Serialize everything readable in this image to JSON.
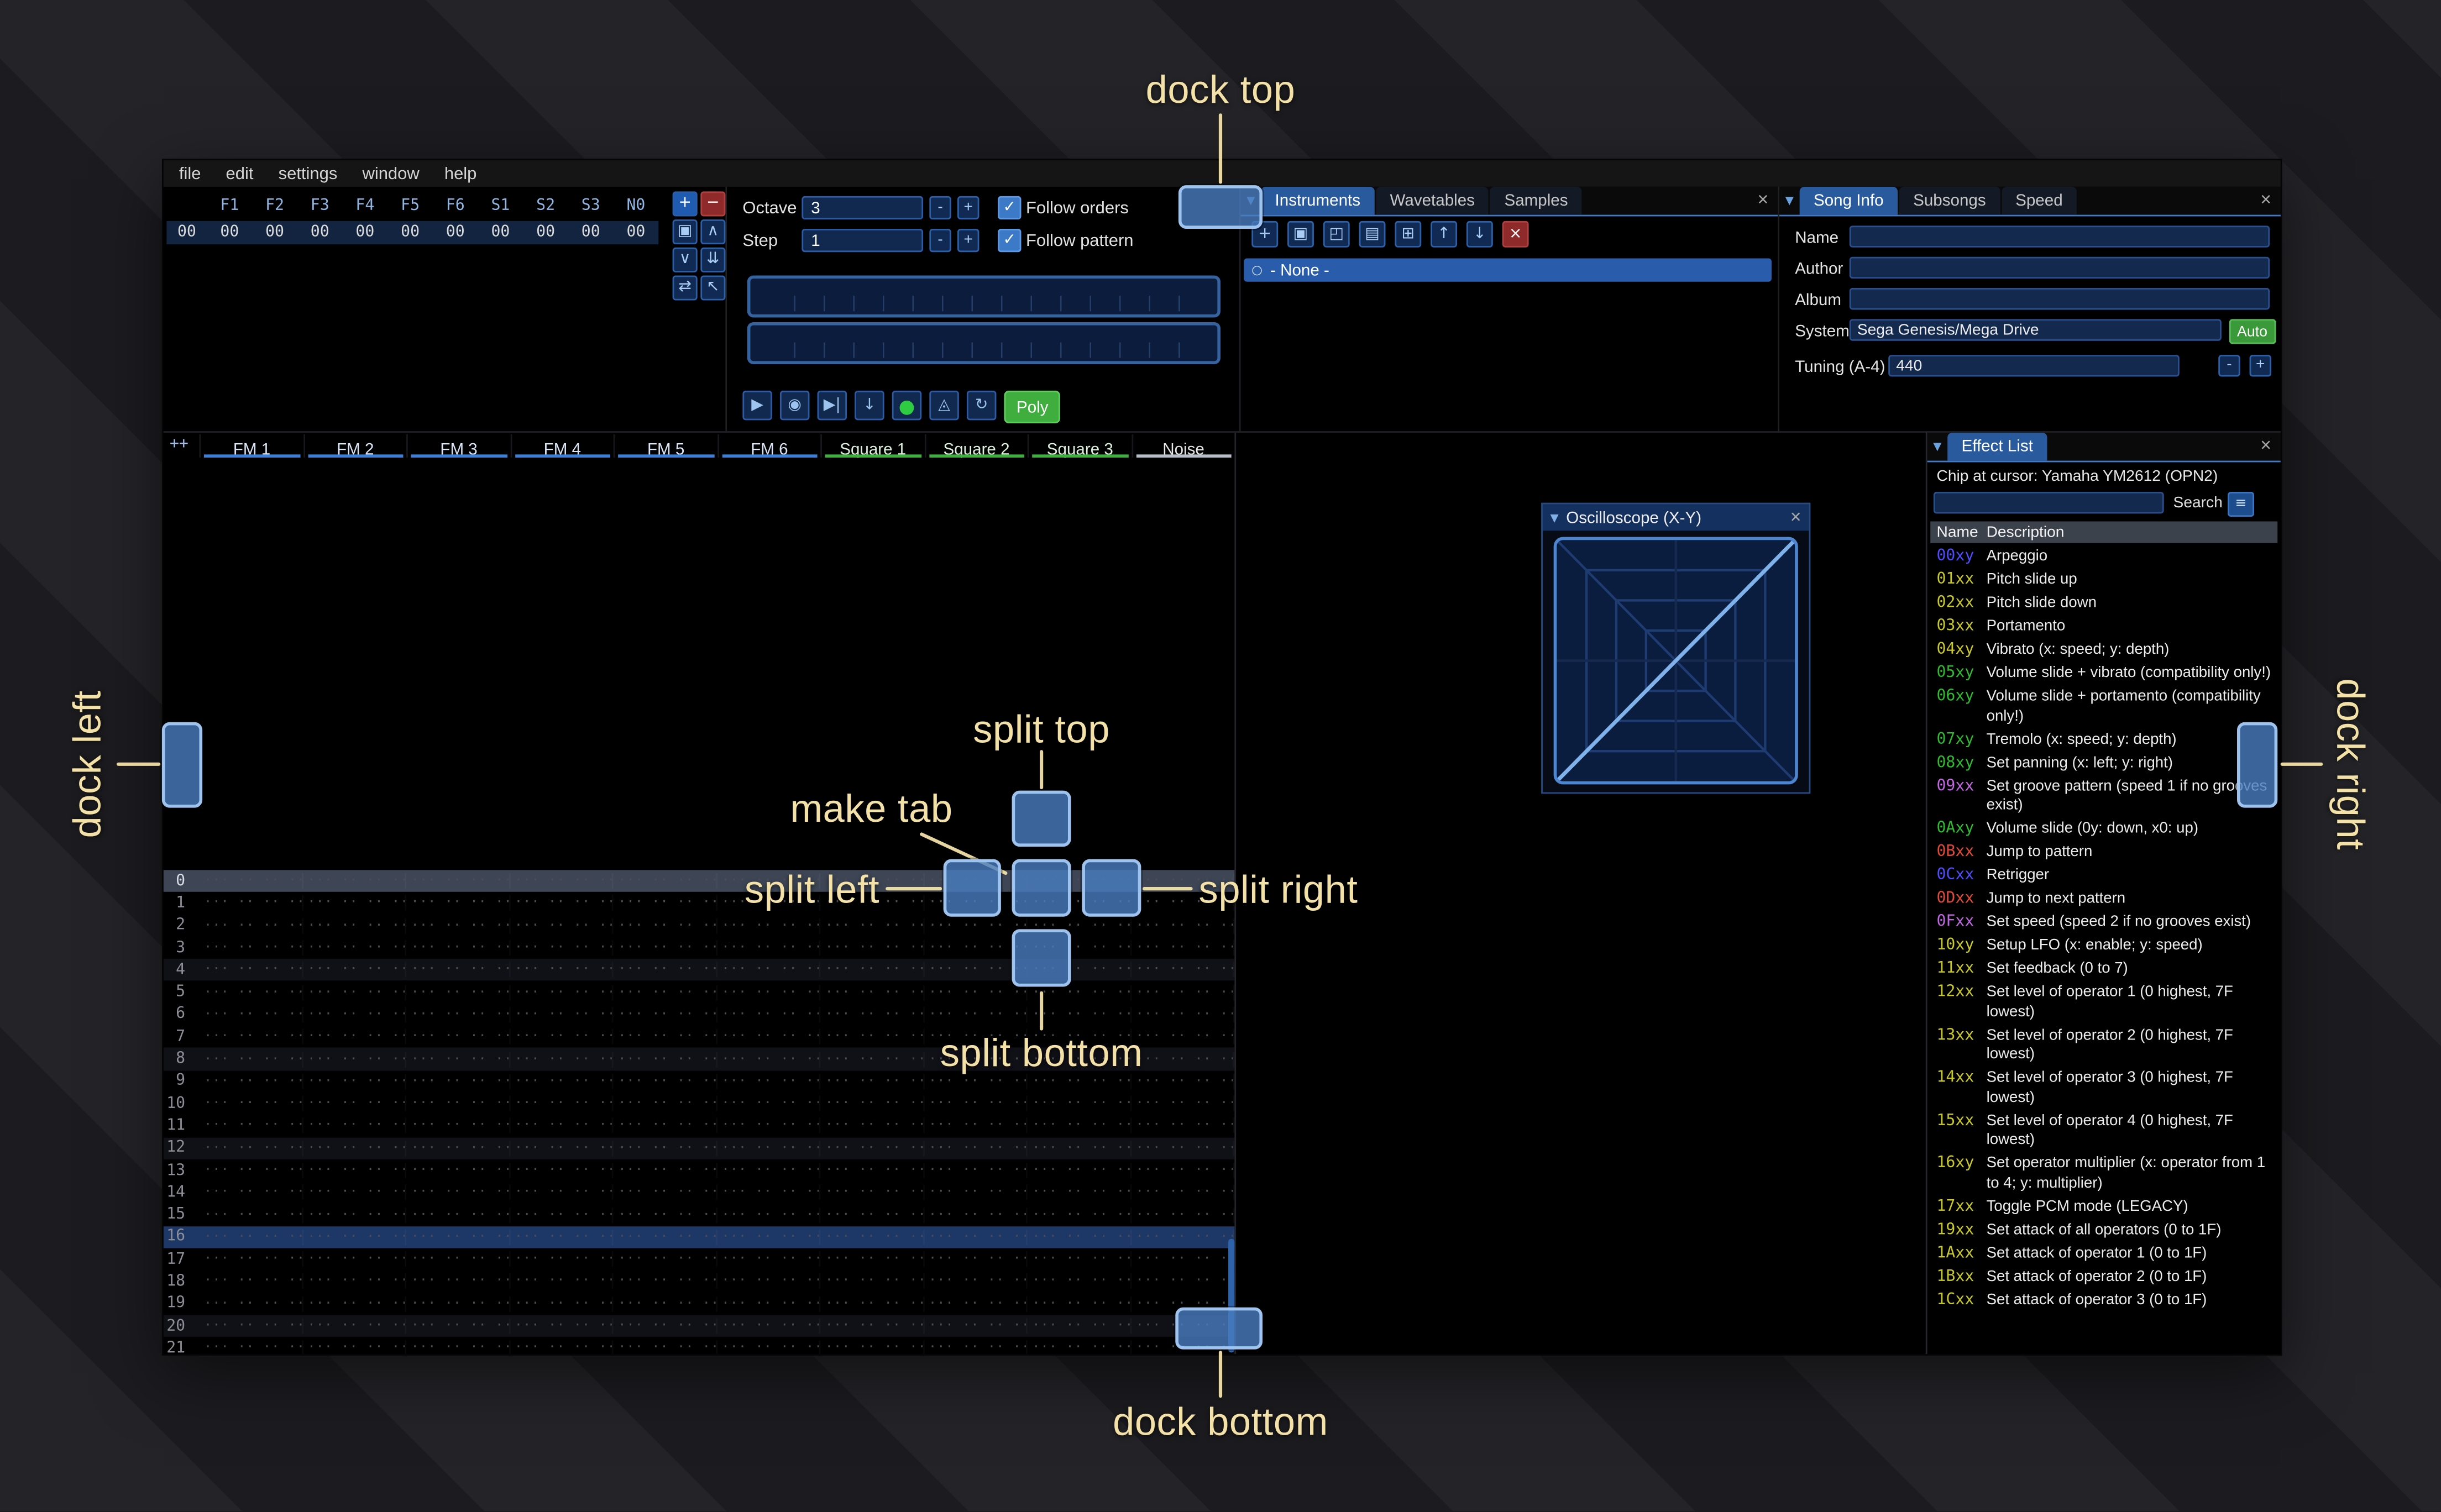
{
  "menu": {
    "items": [
      "file",
      "edit",
      "settings",
      "window",
      "help"
    ]
  },
  "orders": {
    "channels": [
      "F1",
      "F2",
      "F3",
      "F4",
      "F5",
      "F6",
      "S1",
      "S2",
      "S3",
      "N0"
    ],
    "row": {
      "index": "00",
      "cells": [
        "00",
        "00",
        "00",
        "00",
        "00",
        "00",
        "00",
        "00",
        "00",
        "00"
      ]
    },
    "buttons": [
      {
        "name": "order-add-button",
        "glyph": "+",
        "variant": "add"
      },
      {
        "name": "order-remove-button",
        "glyph": "−",
        "variant": "remove"
      },
      {
        "name": "order-duplicate-button",
        "glyph": "▣"
      },
      {
        "name": "order-move-up-button",
        "glyph": "∧"
      },
      {
        "name": "order-move-down-button",
        "glyph": "∨"
      },
      {
        "name": "order-duplicate-end-button",
        "glyph": "⇊"
      },
      {
        "name": "order-change-all-button",
        "glyph": "⇄"
      },
      {
        "name": "order-edit-mode-button",
        "glyph": "↖"
      }
    ]
  },
  "controls": {
    "octave_label": "Octave",
    "octave_value": "3",
    "step_label": "Step",
    "step_value": "1",
    "minus": "-",
    "plus": "+",
    "check": "✓",
    "follow_orders": "Follow orders",
    "follow_pattern": "Follow pattern",
    "transport": [
      {
        "name": "play-button",
        "glyph": "▶"
      },
      {
        "name": "play-pattern-button",
        "glyph": "◉"
      },
      {
        "name": "play-once-button",
        "glyph": "▶|"
      },
      {
        "name": "step-row-button",
        "glyph": "↓"
      },
      {
        "name": "edit-record-toggle",
        "glyph": "●",
        "variant": "record"
      },
      {
        "name": "metronome-button",
        "glyph": "◬"
      },
      {
        "name": "repeat-pattern-button",
        "glyph": "↻"
      }
    ],
    "poly_label": "Poly"
  },
  "instruments": {
    "tabs": [
      "Instruments",
      "Wavetables",
      "Samples"
    ],
    "toolbar": [
      {
        "name": "instrument-add-button",
        "glyph": "+"
      },
      {
        "name": "instrument-duplicate-button",
        "glyph": "▣"
      },
      {
        "name": "instrument-open-button",
        "glyph": "◰"
      },
      {
        "name": "instrument-save-button",
        "glyph": "▤"
      },
      {
        "name": "instrument-folder-button",
        "glyph": "⊞"
      },
      {
        "name": "instrument-move-up-button",
        "glyph": "↑"
      },
      {
        "name": "instrument-move-down-button",
        "glyph": "↓"
      },
      {
        "name": "instrument-delete-button",
        "glyph": "×",
        "variant": "danger"
      }
    ],
    "list": [
      {
        "bullet": "○",
        "label": "- None -"
      }
    ]
  },
  "song_info": {
    "tabs": [
      "Song Info",
      "Subsongs",
      "Speed"
    ],
    "fields": [
      {
        "label": "Name",
        "value": ""
      },
      {
        "label": "Author",
        "value": ""
      },
      {
        "label": "Album",
        "value": ""
      }
    ],
    "system_label": "System",
    "system_value": "Sega Genesis/Mega Drive",
    "auto_label": "Auto",
    "tuning_label": "Tuning (A-4)",
    "tuning_value": "440",
    "minus": "-",
    "plus": "+"
  },
  "pattern": {
    "corner": "++",
    "channels": [
      {
        "label": "FM 1",
        "type": "fm"
      },
      {
        "label": "FM 2",
        "type": "fm"
      },
      {
        "label": "FM 3",
        "type": "fm"
      },
      {
        "label": "FM 4",
        "type": "fm"
      },
      {
        "label": "FM 5",
        "type": "fm"
      },
      {
        "label": "FM 6",
        "type": "fm"
      },
      {
        "label": "Square 1",
        "type": "square"
      },
      {
        "label": "Square 2",
        "type": "square"
      },
      {
        "label": "Square 3",
        "type": "square"
      },
      {
        "label": "Noise",
        "type": "noise"
      }
    ],
    "empty_cell": "··· ·· ·· ····",
    "rows": [
      {
        "n": "0",
        "hl": "cursor"
      },
      {
        "n": "1"
      },
      {
        "n": "2"
      },
      {
        "n": "3"
      },
      {
        "n": "4",
        "hl": "minor"
      },
      {
        "n": "5"
      },
      {
        "n": "6"
      },
      {
        "n": "7"
      },
      {
        "n": "8",
        "hl": "minor"
      },
      {
        "n": "9"
      },
      {
        "n": "10"
      },
      {
        "n": "11"
      },
      {
        "n": "12",
        "hl": "minor"
      },
      {
        "n": "13"
      },
      {
        "n": "14"
      },
      {
        "n": "15"
      },
      {
        "n": "16",
        "hl": "major"
      },
      {
        "n": "17"
      },
      {
        "n": "18"
      },
      {
        "n": "19"
      },
      {
        "n": "20",
        "hl": "minor"
      },
      {
        "n": "21"
      }
    ]
  },
  "oscilloscope": {
    "title": "Oscilloscope (X-Y)"
  },
  "effect_list": {
    "tab": "Effect List",
    "chip_line": "Chip at cursor: Yamaha YM2612 (OPN2)",
    "search_label": "Search",
    "columns": [
      "Name",
      "Description"
    ],
    "palette": {
      "blue": "#4d4dff",
      "yellow": "#c9c929",
      "green": "#2fbb2f",
      "purple": "#bf66e0",
      "red": "#e0483a"
    },
    "effects": [
      {
        "code": "00xy",
        "desc": "Arpeggio",
        "color": "blue"
      },
      {
        "code": "01xx",
        "desc": "Pitch slide up",
        "color": "yellow"
      },
      {
        "code": "02xx",
        "desc": "Pitch slide down",
        "color": "yellow"
      },
      {
        "code": "03xx",
        "desc": "Portamento",
        "color": "yellow"
      },
      {
        "code": "04xy",
        "desc": "Vibrato (x: speed; y: depth)",
        "color": "yellow"
      },
      {
        "code": "05xy",
        "desc": "Volume slide + vibrato (compatibility only!)",
        "color": "green"
      },
      {
        "code": "06xy",
        "desc": "Volume slide + portamento (compatibility only!)",
        "color": "green"
      },
      {
        "code": "07xy",
        "desc": "Tremolo (x: speed; y: depth)",
        "color": "green"
      },
      {
        "code": "08xy",
        "desc": "Set panning (x: left; y: right)",
        "color": "green"
      },
      {
        "code": "09xx",
        "desc": "Set groove pattern (speed 1 if no grooves exist)",
        "color": "purple"
      },
      {
        "code": "0Axy",
        "desc": "Volume slide (0y: down, x0: up)",
        "color": "green"
      },
      {
        "code": "0Bxx",
        "desc": "Jump to pattern",
        "color": "red"
      },
      {
        "code": "0Cxx",
        "desc": "Retrigger",
        "color": "blue"
      },
      {
        "code": "0Dxx",
        "desc": "Jump to next pattern",
        "color": "red"
      },
      {
        "code": "0Fxx",
        "desc": "Set speed (speed 2 if no grooves exist)",
        "color": "purple"
      },
      {
        "code": "10xy",
        "desc": "Setup LFO (x: enable; y: speed)",
        "color": "yellow"
      },
      {
        "code": "11xx",
        "desc": "Set feedback (0 to 7)",
        "color": "yellow"
      },
      {
        "code": "12xx",
        "desc": "Set level of operator 1 (0 highest, 7F lowest)",
        "color": "yellow"
      },
      {
        "code": "13xx",
        "desc": "Set level of operator 2 (0 highest, 7F lowest)",
        "color": "yellow"
      },
      {
        "code": "14xx",
        "desc": "Set level of operator 3 (0 highest, 7F lowest)",
        "color": "yellow"
      },
      {
        "code": "15xx",
        "desc": "Set level of operator 4 (0 highest, 7F lowest)",
        "color": "yellow"
      },
      {
        "code": "16xy",
        "desc": "Set operator multiplier (x: operator from 1 to 4; y: multiplier)",
        "color": "yellow"
      },
      {
        "code": "17xx",
        "desc": "Toggle PCM mode (LEGACY)",
        "color": "yellow"
      },
      {
        "code": "19xx",
        "desc": "Set attack of all operators (0 to 1F)",
        "color": "yellow"
      },
      {
        "code": "1Axx",
        "desc": "Set attack of operator 1 (0 to 1F)",
        "color": "yellow"
      },
      {
        "code": "1Bxx",
        "desc": "Set attack of operator 2 (0 to 1F)",
        "color": "yellow"
      },
      {
        "code": "1Cxx",
        "desc": "Set attack of operator 3 (0 to 1F)",
        "color": "yellow"
      }
    ]
  },
  "icons": {
    "tab_menu": "▼",
    "collapse": "▼",
    "close": "×",
    "hamburger": "≡"
  },
  "annotations": {
    "dock_top": "dock top",
    "dock_bottom": "dock bottom",
    "dock_left": "dock left",
    "dock_right": "dock right",
    "split_top": "split top",
    "split_bottom": "split bottom",
    "split_left": "split left",
    "split_right": "split right",
    "make_tab": "make tab"
  },
  "colors": {
    "accent": "#2a5a9e",
    "panel_border": "#4179c4",
    "annotation": "#f3e1a7",
    "record_green": "#2ecc40",
    "poly_green": "#3fae3f",
    "auto_green": "#3a9a3a",
    "fm_channel": "#3d7fd6",
    "square_channel": "#3fae3f",
    "noise_channel": "#b9bfc9"
  }
}
